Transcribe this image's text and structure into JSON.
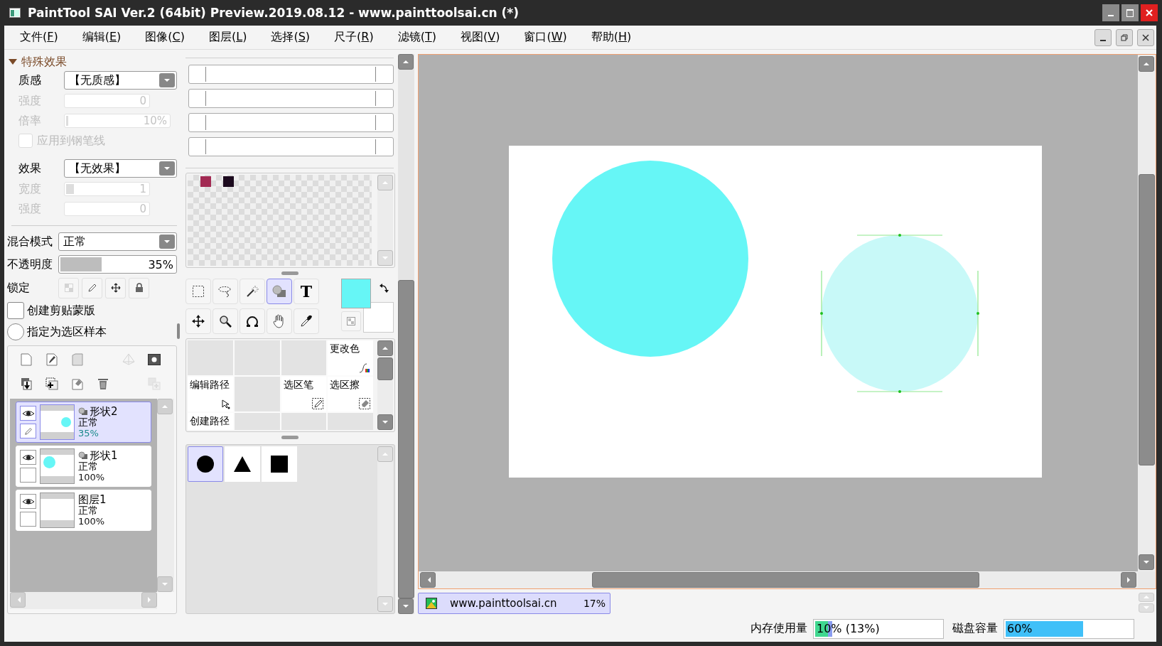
{
  "window": {
    "title": "PaintTool SAI Ver.2 (64bit) Preview.2019.08.12 - www.painttoolsai.cn (*)"
  },
  "menu": [
    {
      "parts": [
        "文件(",
        "F",
        ")"
      ]
    },
    {
      "parts": [
        "编辑(",
        "E",
        ")"
      ]
    },
    {
      "parts": [
        "图像(",
        "C",
        ")"
      ]
    },
    {
      "parts": [
        "图层(",
        "L",
        ")"
      ]
    },
    {
      "parts": [
        "选择(",
        "S",
        ")"
      ]
    },
    {
      "parts": [
        "尺子(",
        "R",
        ")"
      ]
    },
    {
      "parts": [
        "滤镜(",
        "T",
        ")"
      ]
    },
    {
      "parts": [
        "视图(",
        "V",
        ")"
      ]
    },
    {
      "parts": [
        "窗口(",
        "W",
        ")"
      ]
    },
    {
      "parts": [
        "帮助(",
        "H",
        ")"
      ]
    }
  ],
  "effects": {
    "title": "特殊效果",
    "expanded": true,
    "rows": [
      {
        "kind": "dropdown",
        "label": "质感",
        "value": "【无质感】",
        "disabled": false
      },
      {
        "kind": "number",
        "label": "强度",
        "value": "0",
        "disabled": true
      },
      {
        "kind": "slider",
        "label": "倍率",
        "value": "10%",
        "level": 0.02,
        "disabled": true
      },
      {
        "kind": "checkbox",
        "label": "应用到钢笔线",
        "checked": false,
        "disabled": true
      },
      {
        "kind": "dropdown",
        "label": "效果",
        "value": "【无效果】",
        "disabled": false
      },
      {
        "kind": "number",
        "label": "宽度",
        "value": "1",
        "level": 0.09,
        "disabled": true
      },
      {
        "kind": "number",
        "label": "强度",
        "value": "0",
        "disabled": true
      }
    ]
  },
  "layer_props": {
    "blend": {
      "label": "混合模式",
      "value": "正常"
    },
    "opacity": {
      "label": "不透明度",
      "value": "35%",
      "level": 0.35
    },
    "lock": {
      "label": "锁定",
      "buttons": [
        {
          "kind": "transparency",
          "disabled": true
        },
        {
          "kind": "pencil",
          "disabled": false
        },
        {
          "kind": "move",
          "disabled": false
        },
        {
          "kind": "padlock",
          "disabled": false
        }
      ]
    },
    "clipping": {
      "label": "创建剪贴蒙版",
      "checked": false
    },
    "sample": {
      "label": "指定为选区样本",
      "selected": false
    }
  },
  "layer_tools": [
    {
      "kind": "new-page",
      "disabled": false
    },
    {
      "kind": "pen-page",
      "disabled": false
    },
    {
      "kind": "folder",
      "disabled": false
    },
    {
      "kind": "spacer"
    },
    {
      "kind": "perspective",
      "disabled": true
    },
    {
      "kind": "mask",
      "disabled": false
    },
    {
      "kind": "merge-down",
      "disabled": false
    },
    {
      "kind": "add",
      "disabled": false
    },
    {
      "kind": "eraser",
      "disabled": false
    },
    {
      "kind": "trash",
      "disabled": false
    },
    {
      "kind": "spacer"
    },
    {
      "kind": "copy",
      "disabled": true
    }
  ],
  "layers": [
    {
      "name": "形状2",
      "mode": "正常",
      "opacity": "35%",
      "selected": true,
      "visible": true,
      "editing": true,
      "shape": true,
      "kind": "dot-right"
    },
    {
      "name": "形状1",
      "mode": "正常",
      "opacity": "100%",
      "selected": false,
      "visible": true,
      "editing": false,
      "shape": true,
      "kind": "dot-left"
    },
    {
      "name": "图层1",
      "mode": "正常",
      "opacity": "100%",
      "selected": false,
      "visible": true,
      "editing": false,
      "shape": false,
      "kind": "blank"
    }
  ],
  "color_sliders": [
    {
      "level": 0.08
    },
    {
      "level": 0.08
    },
    {
      "level": 0.08
    },
    {
      "level": 0.08
    }
  ],
  "swatches": [
    {
      "color": "#a22a53"
    },
    {
      "color": "#1c0a1e"
    }
  ],
  "tools": [
    {
      "kind": "rect-select",
      "selected": false
    },
    {
      "kind": "lasso",
      "selected": false
    },
    {
      "kind": "wand",
      "selected": false
    },
    {
      "kind": "shapes",
      "selected": true
    },
    {
      "kind": "text",
      "glyph": "T",
      "selected": false
    },
    {
      "kind": "move",
      "selected": false
    },
    {
      "kind": "zoom",
      "selected": false
    },
    {
      "kind": "rotate",
      "selected": false
    },
    {
      "kind": "hand",
      "selected": false
    },
    {
      "kind": "eyedropper",
      "selected": false
    }
  ],
  "colors": [
    {
      "color": "#66f6f6"
    },
    {
      "color": "#ffffff"
    }
  ],
  "tool_slots": [
    {
      "kind": "empty"
    },
    {
      "kind": "empty"
    },
    {
      "kind": "empty"
    },
    {
      "kind": "curve",
      "label": "更改色"
    },
    {
      "kind": "pointer",
      "label": "编辑路径"
    },
    {
      "kind": "empty"
    },
    {
      "kind": "select-pen",
      "label": "选区笔"
    },
    {
      "kind": "select-eraser",
      "label": "选区擦"
    },
    {
      "kind": "plain",
      "label": "创建路径"
    },
    {
      "kind": "empty"
    },
    {
      "kind": "empty"
    },
    {
      "kind": "empty"
    }
  ],
  "shapes": [
    {
      "kind": "circle",
      "selected": true
    },
    {
      "kind": "triangle",
      "selected": false
    },
    {
      "kind": "square",
      "selected": false
    }
  ],
  "canvas": {
    "shapes": [
      {
        "kind": "circle",
        "selected": false
      },
      {
        "kind": "circle",
        "selected": true
      }
    ]
  },
  "navigator": {
    "name": "www.painttoolsai.cn",
    "zoom": "17%"
  },
  "status": {
    "memory": {
      "label": "内存使用量",
      "value": "10% (13%)",
      "level": 0.1
    },
    "disk": {
      "label": "磁盘容量",
      "value": "60%",
      "level": 0.6
    }
  }
}
